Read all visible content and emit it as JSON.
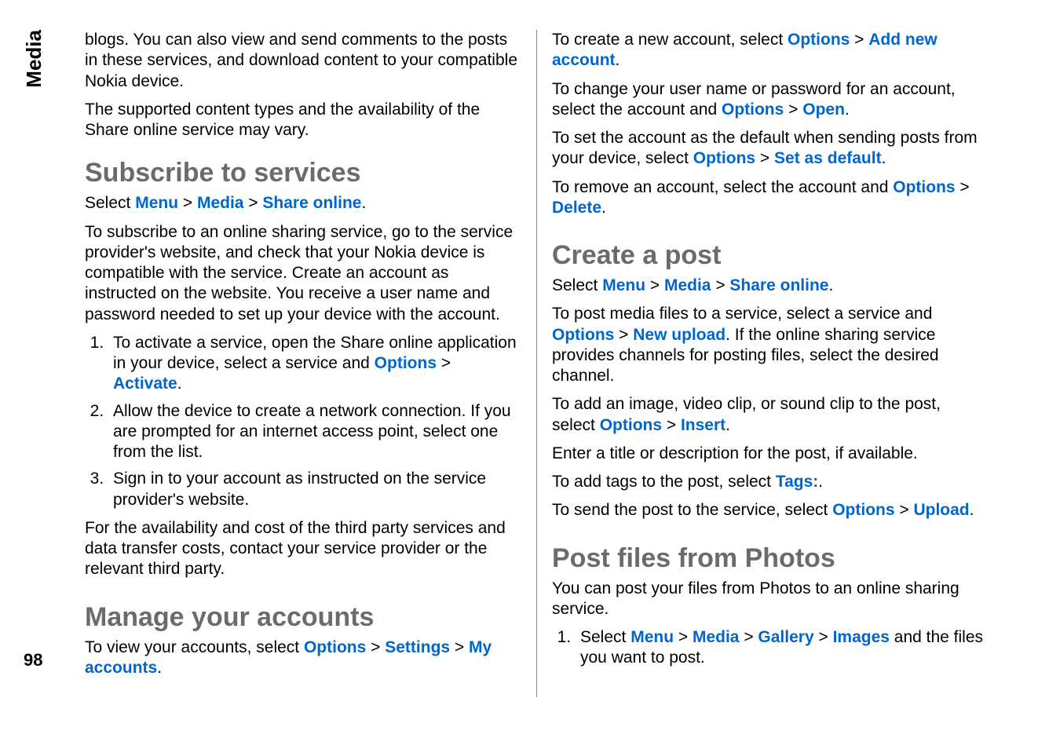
{
  "sideLabel": "Media",
  "pageNumber": "98",
  "col1": {
    "intro1": "blogs. You can also view and send comments to the posts in these services, and download content to your compatible Nokia device.",
    "intro2": "The supported content types and the availability of the Share online service may vary.",
    "subscribe": {
      "title": "Subscribe to services",
      "select_prefix": "Select ",
      "menu": "Menu",
      "sep": " > ",
      "media": "Media",
      "share": "Share online",
      "period": ".",
      "p1": "To subscribe to an online sharing service, go to the service provider's website, and check that your Nokia device is compatible with the service. Create an account as instructed on the website. You receive a user name and password needed to set up your device with the account.",
      "li1_a": "To activate a service, open the Share online application in your device, select a service and ",
      "options": "Options",
      "activate": "Activate",
      "li2": "Allow the device to create a network connection. If you are prompted for an internet access point, select one from the list.",
      "li3": "Sign in to your account as instructed on the service provider's website.",
      "p2": "For the availability and cost of the third party services and data transfer costs, contact your service provider or the relevant third party."
    },
    "manage": {
      "title": "Manage your accounts",
      "p1_a": "To view your accounts, select ",
      "options": "Options",
      "settings": "Settings",
      "my_accounts": "My accounts"
    }
  },
  "col2": {
    "create_new_a": "To create a new account, select ",
    "options": "Options",
    "sep": " > ",
    "add_new_account": "Add new account",
    "period": ".",
    "change_a": "To change your user name or password for an account, select the account and ",
    "open": "Open",
    "default_a": "To set the account as the default when sending posts from your device, select ",
    "set_default": "Set as default",
    "remove_a": "To remove an account, select the account and ",
    "delete": "Delete",
    "create_post": {
      "title": "Create a post",
      "select_prefix": "Select ",
      "menu": "Menu",
      "media": "Media",
      "share": "Share online",
      "p1_a": "To post media files to a service, select a service and ",
      "new_upload": "New upload",
      "p1_b": ". If the online sharing service provides channels for posting files, select the desired channel.",
      "p2_a": "To add an image, video clip, or sound clip to the post, select ",
      "insert": "Insert",
      "p3": "Enter a title or description for the post, if available.",
      "p4_a": "To add tags to the post, select ",
      "tags": "Tags:",
      "p5_a": "To send the post to the service, select ",
      "upload": "Upload"
    },
    "post_files": {
      "title": "Post files from Photos",
      "p1": "You can post your files from Photos to an online sharing service.",
      "li1_a": "Select ",
      "menu": "Menu",
      "media": "Media",
      "gallery": "Gallery",
      "images": "Images",
      "li1_b": " and the files you want to post."
    }
  }
}
